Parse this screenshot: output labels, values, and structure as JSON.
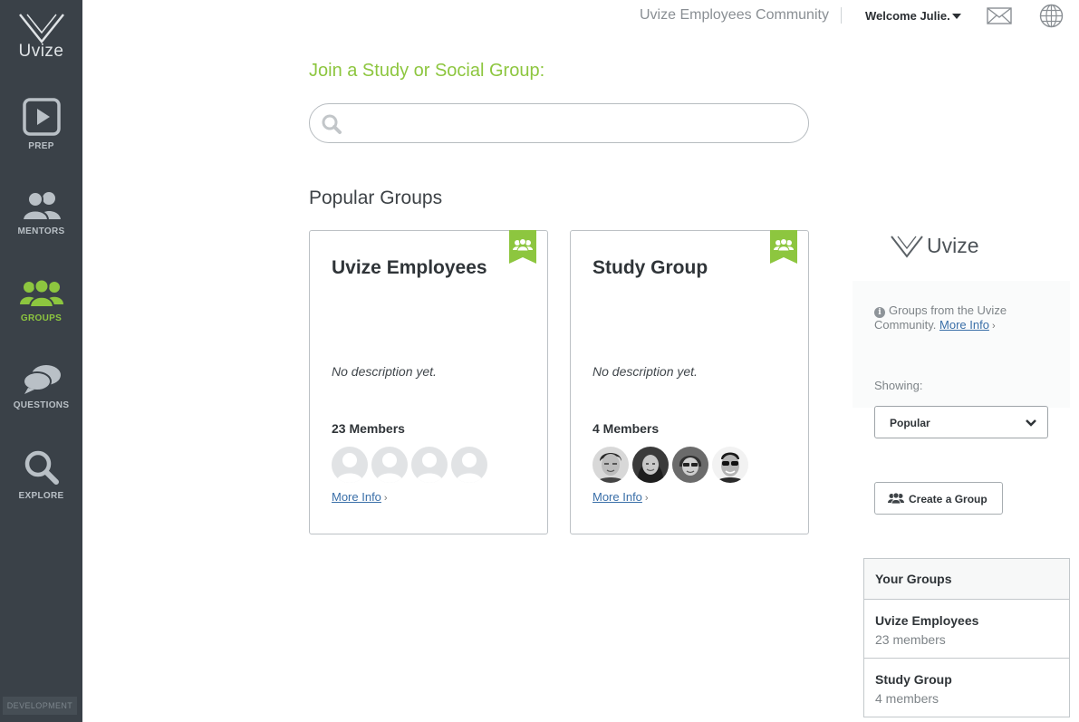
{
  "brand": {
    "name": "Uvize"
  },
  "sidebar": {
    "items": [
      {
        "label": "PREP",
        "icon": "play-icon"
      },
      {
        "label": "MENTORS",
        "icon": "mentors-icon"
      },
      {
        "label": "GROUPS",
        "icon": "groups-icon",
        "active": true
      },
      {
        "label": "QUESTIONS",
        "icon": "chat-bubbles-icon"
      },
      {
        "label": "EXPLORE",
        "icon": "search-icon"
      }
    ],
    "env_badge": "DEVELOPMENT"
  },
  "topbar": {
    "community": "Uvize Employees Community",
    "welcome": "Welcome Julie.",
    "mail_icon": "envelope-icon",
    "globe_icon": "globe-icon"
  },
  "main": {
    "join_title": "Join a Study or Social Group:",
    "search": {
      "placeholder": "",
      "value": ""
    },
    "popular_title": "Popular Groups",
    "cards": [
      {
        "name": "Uvize Employees",
        "description": "No description yet.",
        "members": "23 Members",
        "more_info": "More Info",
        "avatars": "placeholder"
      },
      {
        "name": "Study Group",
        "description": "No description yet.",
        "members": "4 Members",
        "more_info": "More Info",
        "avatars": "photos"
      }
    ]
  },
  "right_panel": {
    "logo_text": "Uvize",
    "info_text": "Groups from the Uvize Community.",
    "info_link": "More Info",
    "showing_label": "Showing:",
    "showing_value": "Popular",
    "create_label": "Create a Group",
    "your_groups": {
      "title": "Your Groups",
      "items": [
        {
          "name": "Uvize Employees",
          "count": "23 members"
        },
        {
          "name": "Study Group",
          "count": "4 members"
        }
      ]
    }
  },
  "colors": {
    "accent": "#8dc63f",
    "sidebar_bg": "#3a4148",
    "link": "#3a6fa8"
  }
}
